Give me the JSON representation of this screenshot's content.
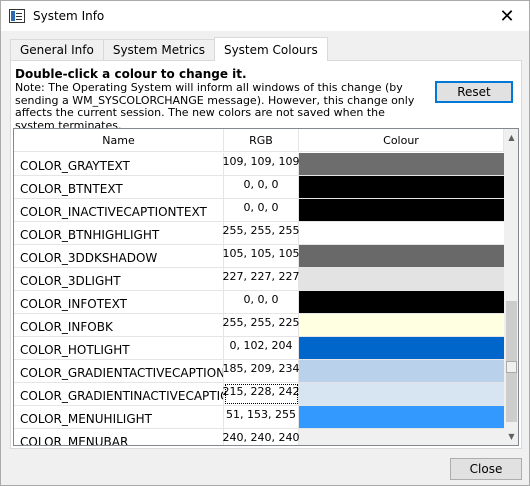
{
  "window": {
    "title": "System Info",
    "close_glyph": "✕"
  },
  "tabs": [
    {
      "label": "General Info"
    },
    {
      "label": "System Metrics"
    },
    {
      "label": "System Colours"
    }
  ],
  "panel": {
    "headline": "Double-click a colour to change it.",
    "note": "Note: The Operating System will inform all windows of this change (by sending a WM_SYSCOLORCHANGE message). However, this change only affects the current session. The new colors are not saved when the system terminates.",
    "reset_label": "Reset"
  },
  "grid": {
    "columns": [
      "Name",
      "RGB",
      "Colour"
    ],
    "rows": [
      {
        "name": "COLOR_GRAYTEXT",
        "rgb": "109, 109, 109",
        "color": "#6d6d6d"
      },
      {
        "name": "COLOR_BTNTEXT",
        "rgb": "0, 0, 0",
        "color": "#000000"
      },
      {
        "name": "COLOR_INACTIVECAPTIONTEXT",
        "rgb": "0, 0, 0",
        "color": "#000000"
      },
      {
        "name": "COLOR_BTNHIGHLIGHT",
        "rgb": "255, 255, 255",
        "color": "#ffffff"
      },
      {
        "name": "COLOR_3DDKSHADOW",
        "rgb": "105, 105, 105",
        "color": "#696969"
      },
      {
        "name": "COLOR_3DLIGHT",
        "rgb": "227, 227, 227",
        "color": "#e3e3e3"
      },
      {
        "name": "COLOR_INFOTEXT",
        "rgb": "0, 0, 0",
        "color": "#000000"
      },
      {
        "name": "COLOR_INFOBK",
        "rgb": "255, 255, 225",
        "color": "#ffffe1"
      },
      {
        "name": "COLOR_HOTLIGHT",
        "rgb": "0, 102, 204",
        "color": "#0066cc"
      },
      {
        "name": "COLOR_GRADIENTACTIVECAPTION",
        "rgb": "185, 209, 234",
        "color": "#b9d1ea"
      },
      {
        "name": "COLOR_GRADIENTINACTIVECAPTION",
        "rgb": "215, 228, 242",
        "color": "#d7e4f2"
      },
      {
        "name": "COLOR_MENUHILIGHT",
        "rgb": "51, 153, 255",
        "color": "#3399ff"
      },
      {
        "name": "COLOR_MENUBAR",
        "rgb": "240, 240, 240",
        "color": "#f0f0f0"
      }
    ]
  },
  "footer": {
    "close_label": "Close"
  }
}
